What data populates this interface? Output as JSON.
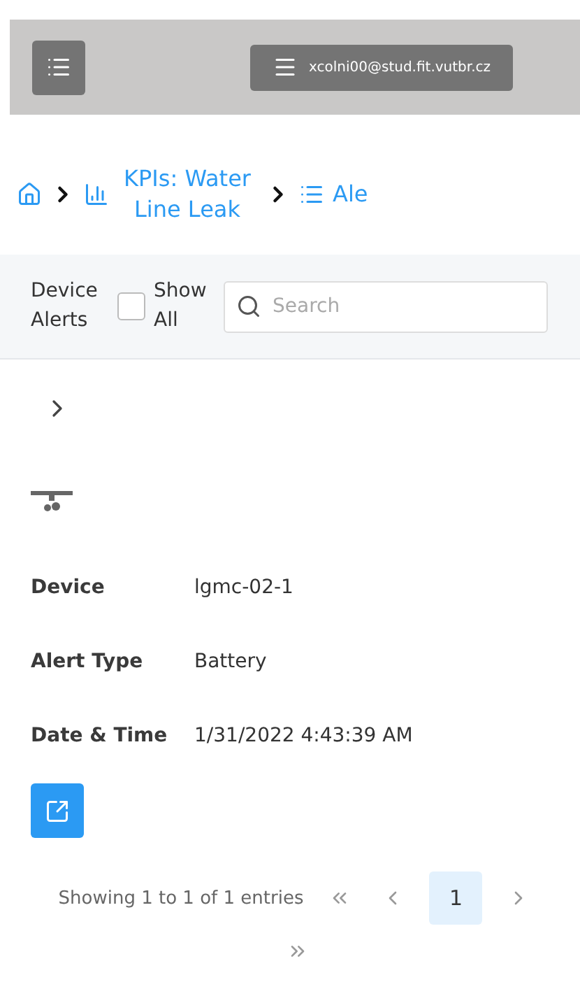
{
  "header": {
    "user": "xcolni00@stud.fit.vutbr.cz"
  },
  "breadcrumb": [
    {
      "kind": "home"
    },
    {
      "kind": "chart",
      "label": "KPIs: Water Line Leak"
    },
    {
      "kind": "list",
      "label": "Ale"
    }
  ],
  "toolbar": {
    "title": "Device Alerts",
    "show_all": {
      "label": "Show All",
      "checked": false
    },
    "search": {
      "placeholder": "Search"
    }
  },
  "alert": {
    "expanded": false,
    "fields": [
      {
        "label": "Device",
        "value": "lgmc-02-1"
      },
      {
        "label": "Alert Type",
        "value": "Battery"
      },
      {
        "label": "Date & Time",
        "value": "1/31/2022 4:43:39 AM"
      }
    ]
  },
  "pagination": {
    "summary": "Showing 1 to 1 of 1 entries",
    "pages": [
      {
        "label": "1",
        "selected": true
      }
    ]
  }
}
